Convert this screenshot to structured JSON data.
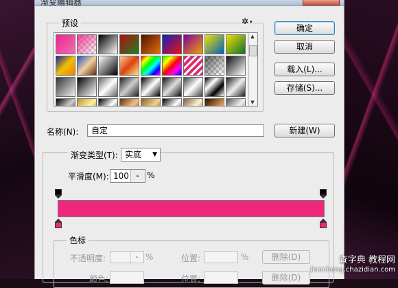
{
  "window": {
    "title": "渐变编辑器"
  },
  "presets": {
    "label": "预设",
    "gear_glyph": "✲",
    "swatches": [
      {
        "id": 0,
        "style": "linear-gradient(135deg,#e8288c,#f46ab4)"
      },
      {
        "id": 1,
        "style": "checker-pink"
      },
      {
        "id": 2,
        "style": "linear-gradient(135deg,#000,#fff)"
      },
      {
        "id": 3,
        "style": "linear-gradient(135deg,#b01010,#208020)"
      },
      {
        "id": 4,
        "style": "linear-gradient(135deg,#501000,#e07010)"
      },
      {
        "id": 5,
        "style": "linear-gradient(135deg,#1020c0,#f01010)"
      },
      {
        "id": 6,
        "style": "linear-gradient(135deg,#8000a0,#f0a000)"
      },
      {
        "id": 7,
        "style": "linear-gradient(135deg,#f0e000,#0060c0)"
      },
      {
        "id": 8,
        "style": "linear-gradient(135deg,#f0e000,#107030)"
      },
      {
        "id": 9,
        "style": "linear-gradient(135deg,#1020a0,#f0c000,#f08000)"
      },
      {
        "id": 10,
        "style": "linear-gradient(135deg,#2050c0,#f0d0a0,#603010)"
      },
      {
        "id": 11,
        "style": "linear-gradient(135deg,#fff,#000)"
      },
      {
        "id": 12,
        "style": "linear-gradient(135deg,#f0d090,#e04010,#f0f090)"
      },
      {
        "id": 13,
        "style": "linear-gradient(135deg,#f00,#ff0,#0f0,#0ff,#00f,#f0f)"
      },
      {
        "id": 14,
        "style": "linear-gradient(135deg,#0f0,#ff0,#f00,#f0f,#00f)"
      },
      {
        "id": 15,
        "style": "repeating-linear-gradient(135deg,#e02870 0 4px,#fff 4px 7px)"
      },
      {
        "id": 16,
        "style": "checker-gray"
      },
      {
        "id": 17,
        "style": "linear-gradient(135deg,#111,#fff)"
      },
      {
        "id": 18,
        "style": "linear-gradient(135deg,#333,#eee)"
      },
      {
        "id": 19,
        "style": "linear-gradient(135deg,#000,#888,#fff)"
      },
      {
        "id": 20,
        "style": "linear-gradient(135deg,#666,#fff,#666)"
      },
      {
        "id": 21,
        "style": "linear-gradient(135deg,#222,#ccc,#222)"
      },
      {
        "id": 22,
        "style": "linear-gradient(135deg,#000,#fff,#000)"
      },
      {
        "id": 23,
        "style": "linear-gradient(135deg,#111,#ddd,#111)"
      },
      {
        "id": 24,
        "style": "linear-gradient(135deg,#444,#fff,#444)"
      },
      {
        "id": 25,
        "style": "linear-gradient(135deg,#000,#fff,#000,#fff)"
      },
      {
        "id": 26,
        "style": "linear-gradient(135deg,#222,#eee,#222)"
      },
      {
        "id": 27,
        "style": "linear-gradient(135deg,#000,#ccc,#000)"
      },
      {
        "id": 28,
        "style": "linear-gradient(135deg,#c09030,#fff0a0,#805010)"
      },
      {
        "id": 29,
        "style": "linear-gradient(135deg,#000,#fff,#000)"
      },
      {
        "id": 30,
        "style": "linear-gradient(135deg,#603010,#f0c080,#603010)"
      },
      {
        "id": 31,
        "style": "linear-gradient(135deg,#906020,#f0d090,#503010)"
      },
      {
        "id": 32,
        "style": "linear-gradient(135deg,#000,#fff,#000)"
      },
      {
        "id": 33,
        "style": "linear-gradient(135deg,#806040,#fff0d0,#604020)"
      },
      {
        "id": 34,
        "style": "linear-gradient(135deg,#201000,#c08040,#fff)"
      },
      {
        "id": 35,
        "style": "linear-gradient(135deg,#555,#eee,#555)"
      },
      {
        "id": 36,
        "style": "linear-gradient(135deg,#fff,#000,#fff)"
      },
      {
        "id": 37,
        "style": "linear-gradient(135deg,#333,#fff,#333)"
      },
      {
        "id": 38,
        "style": "linear-gradient(135deg,#000,#aaa,#000)"
      },
      {
        "id": 39,
        "style": "linear-gradient(135deg,#806030,#f8e0a0,#806030)"
      },
      {
        "id": 40,
        "style": "linear-gradient(135deg,#205070,#a0d0f0,#205070)"
      },
      {
        "id": 41,
        "style": "linear-gradient(135deg,#204060,#c0e0ff)"
      },
      {
        "id": 42,
        "style": "linear-gradient(135deg,#504040,#f0c0c0)"
      },
      {
        "id": 43,
        "style": "linear-gradient(135deg,#503020,#f0b090)"
      },
      {
        "id": 44,
        "style": "linear-gradient(135deg,#111,#fff)"
      },
      {
        "id": 45,
        "style": "linear-gradient(135deg,#303030,#e0e0e0)"
      },
      {
        "id": 46,
        "style": "linear-gradient(135deg,#000,#888)"
      },
      {
        "id": 47,
        "style": "linear-gradient(135deg,#000,#ddd)"
      },
      {
        "id": 48,
        "style": "linear-gradient(135deg,#303030,#fff)"
      },
      {
        "id": 49,
        "style": "linear-gradient(135deg,#000,#bbb)"
      },
      {
        "id": 50,
        "style": "linear-gradient(135deg,#222,#999)"
      },
      {
        "id": 51,
        "style": "linear-gradient(135deg,#704020,#f0c090)"
      },
      {
        "id": 52,
        "style": "linear-gradient(135deg,#204070,#90c0f0)"
      },
      {
        "id": 53,
        "style": "linear-gradient(135deg,#503050,#e0b0e0)"
      },
      {
        "id": 54,
        "style": "linear-gradient(135deg,#000,#999)"
      },
      {
        "id": 55,
        "style": "linear-gradient(135deg,#000,#fff)"
      }
    ]
  },
  "buttons": {
    "ok": "确定",
    "cancel": "取消",
    "load": "载入(L)...",
    "save": "存储(S)...",
    "new": "新建(W)",
    "delete": "删除(D)"
  },
  "name_field": {
    "label": "名称(N):",
    "value": "自定"
  },
  "gradient_type": {
    "label": "渐变类型(T):",
    "value": "实底"
  },
  "smoothness": {
    "label": "平滑度(M):",
    "value": "100",
    "unit": "%"
  },
  "gradient": {
    "start_color": "#f0287c",
    "end_color": "#f0287c"
  },
  "color_stops": {
    "label": "色标",
    "opacity_label": "不透明度:",
    "opacity_unit": "%",
    "location_label": "位置:",
    "location_unit": "%",
    "color_label": "颜色:",
    "location2_label": "位置:"
  },
  "watermark": {
    "line1": "查字典 教程网",
    "line2": "jiaocheng.chazidian.com"
  }
}
